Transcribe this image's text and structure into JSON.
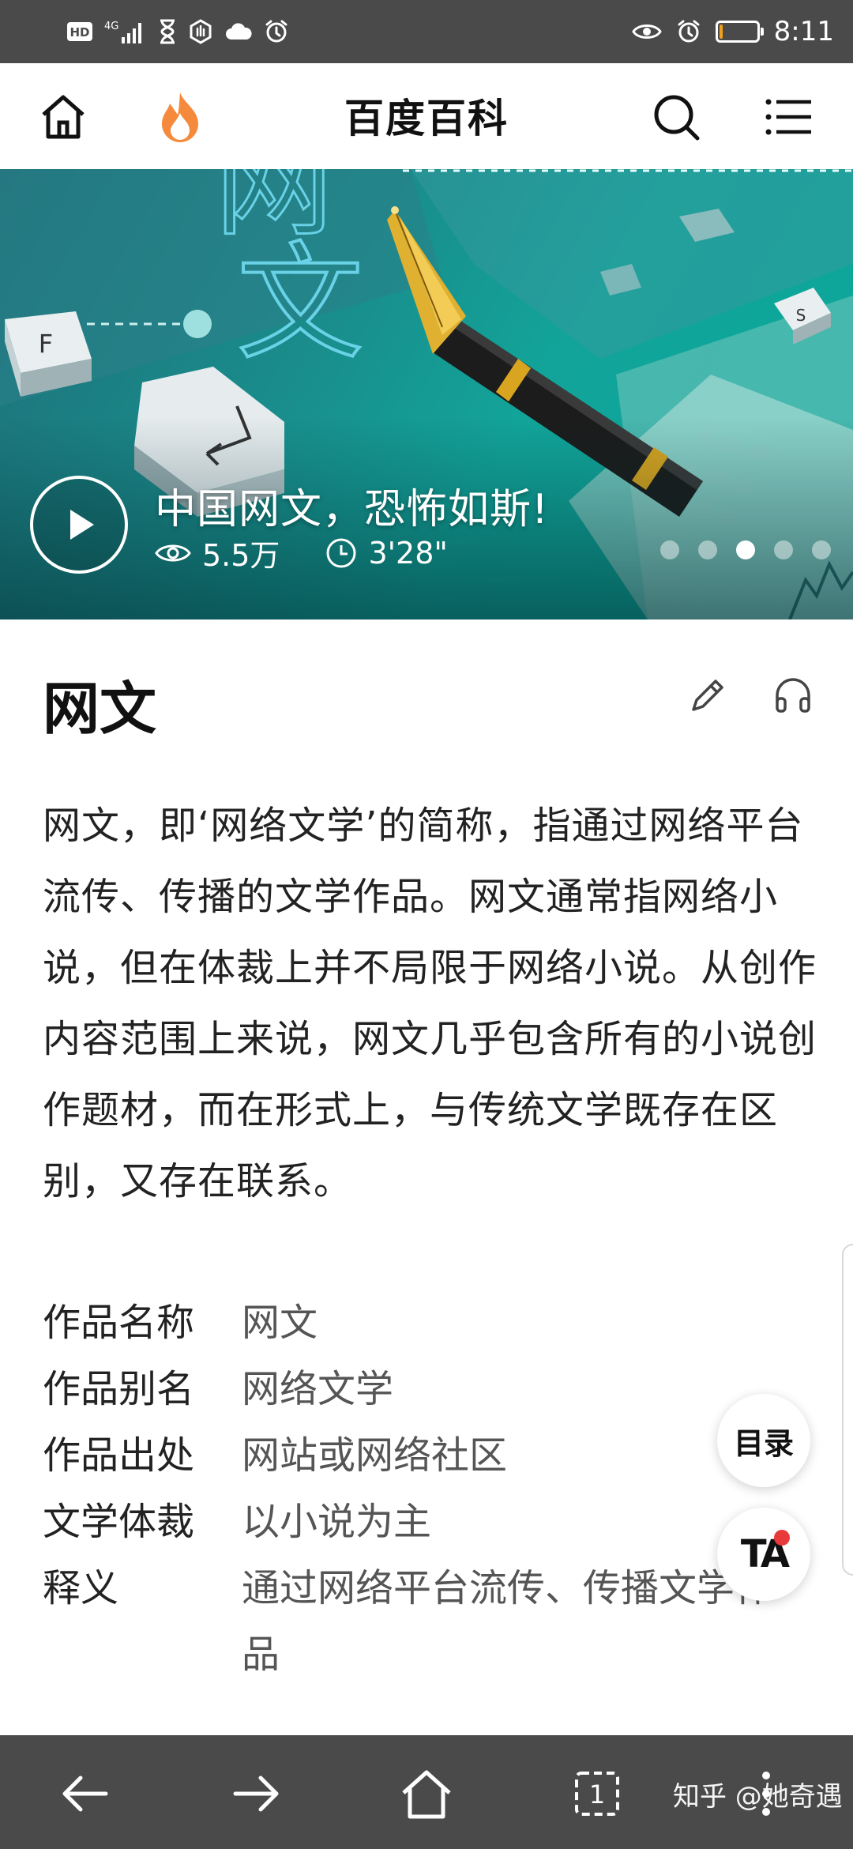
{
  "status_bar": {
    "left_icons": [
      "hd-icon",
      "4g-signal-icon",
      "hourglass-icon",
      "hand-icon",
      "cloud-icon",
      "alarm-clock-icon"
    ],
    "hd_label": "HD",
    "net_label": "4G",
    "right_icons": [
      "eye-icon",
      "alarm-icon",
      "battery-icon"
    ],
    "battery_level_percent": 10,
    "time": "8:11"
  },
  "top_nav": {
    "home_icon": "home-icon",
    "hot_icon": "flame-icon",
    "title": "百度百科",
    "search_icon": "search-icon",
    "menu_icon": "menu-icon",
    "accent": "#f58a3d"
  },
  "hero": {
    "title": "中国网文，恐怖如斯!",
    "views": "5.5万",
    "duration": "3'28\"",
    "slide_count": 5,
    "active_slide": 3,
    "colors": {
      "bg": "#12a49a",
      "pen": "#1a1a1a",
      "gold": "#d9a520"
    },
    "art_chars": [
      "网",
      "文"
    ],
    "keycaps": [
      "F",
      "S"
    ]
  },
  "entry": {
    "title": "网文",
    "edit_icon": "pencil-icon",
    "listen_icon": "headphones-icon",
    "summary": "网文，即‘网络文学’的简称，指通过网络平台流传、传播的文学作品。网文通常指网络小说，但在体裁上并不局限于网络小说。从创作内容范围上来说，网文几乎包含所有的小说创作题材，而在形式上，与传统文学既存在区别，又存在联系。"
  },
  "infobox": [
    {
      "key": "作品名称",
      "value": "网文"
    },
    {
      "key": "作品别名",
      "value": "网络文学"
    },
    {
      "key": "作品出处",
      "value": "网站或网络社区"
    },
    {
      "key": "文学体裁",
      "value": "以小说为主"
    },
    {
      "key": "释义",
      "value": "通过网络平台流传、传播文学作品"
    }
  ],
  "floating": {
    "toc_label": "目录",
    "ta_label": "TA"
  },
  "bottom_bar": {
    "back_icon": "arrow-left-icon",
    "forward_icon": "arrow-right-icon",
    "home_icon": "home-icon",
    "tabs_count": "1",
    "more_icon": "more-icon",
    "watermark": "知乎 @她奇遇"
  }
}
